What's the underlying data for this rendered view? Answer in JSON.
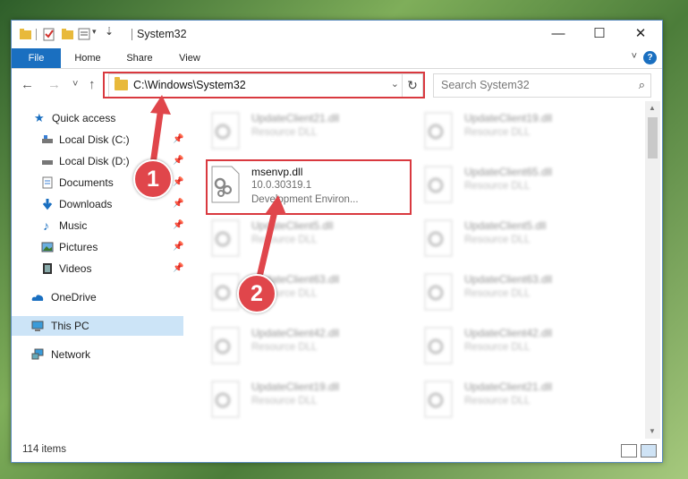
{
  "window": {
    "title": "System32",
    "controls": {
      "minimize": "—",
      "maximize": "☐",
      "close": "✕"
    }
  },
  "ribbon": {
    "tabs": [
      "File",
      "Home",
      "Share",
      "View"
    ],
    "help": "?"
  },
  "nav": {
    "back": "←",
    "forward": "→",
    "recent": "˅",
    "up": "↑",
    "address": "C:\\Windows\\System32",
    "search_placeholder": "Search System32"
  },
  "sidebar": {
    "items": [
      {
        "label": "Quick access",
        "icon": "star-icon",
        "pinned": false
      },
      {
        "label": "Local Disk (C:)",
        "icon": "drive-icon",
        "pinned": true
      },
      {
        "label": "Local Disk (D:)",
        "icon": "drive-icon",
        "pinned": true
      },
      {
        "label": "Documents",
        "icon": "documents-icon",
        "pinned": true
      },
      {
        "label": "Downloads",
        "icon": "downloads-icon",
        "pinned": true
      },
      {
        "label": "Music",
        "icon": "music-icon",
        "pinned": true
      },
      {
        "label": "Pictures",
        "icon": "pictures-icon",
        "pinned": true
      },
      {
        "label": "Videos",
        "icon": "videos-icon",
        "pinned": true
      },
      {
        "label": "OneDrive",
        "icon": "cloud-icon",
        "pinned": false
      },
      {
        "label": "This PC",
        "icon": "computer-icon",
        "pinned": false,
        "selected": true
      },
      {
        "label": "Network",
        "icon": "network-icon",
        "pinned": false
      }
    ]
  },
  "files": {
    "highlighted": {
      "name": "msenvp.dll",
      "version": "10.0.30319.1",
      "description": "Development Environ..."
    },
    "left_column": [
      {
        "name": "UpdateClient21.dll",
        "type": "Resource DLL"
      },
      {
        "name": "UpdateClient5.dll",
        "type": "Resource DLL"
      },
      {
        "name": "UpdateClient63.dll",
        "type": "Resource DLL"
      },
      {
        "name": "UpdateClient42.dll",
        "type": "Resource DLL"
      },
      {
        "name": "UpdateClient19.dll",
        "type": "Resource DLL"
      }
    ],
    "right_column": [
      {
        "name": "UpdateClient19.dll",
        "type": "Resource DLL"
      },
      {
        "name": "UpdateClient65.dll",
        "type": "Resource DLL"
      },
      {
        "name": "UpdateClient5.dll",
        "type": "Resource DLL"
      },
      {
        "name": "UpdateClient63.dll",
        "type": "Resource DLL"
      },
      {
        "name": "UpdateClient42.dll",
        "type": "Resource DLL"
      },
      {
        "name": "UpdateClient21.dll",
        "type": "Resource DLL"
      }
    ]
  },
  "status": {
    "item_count": "114 items"
  },
  "annotations": {
    "step1": "1",
    "step2": "2",
    "color": "#d9393f"
  }
}
